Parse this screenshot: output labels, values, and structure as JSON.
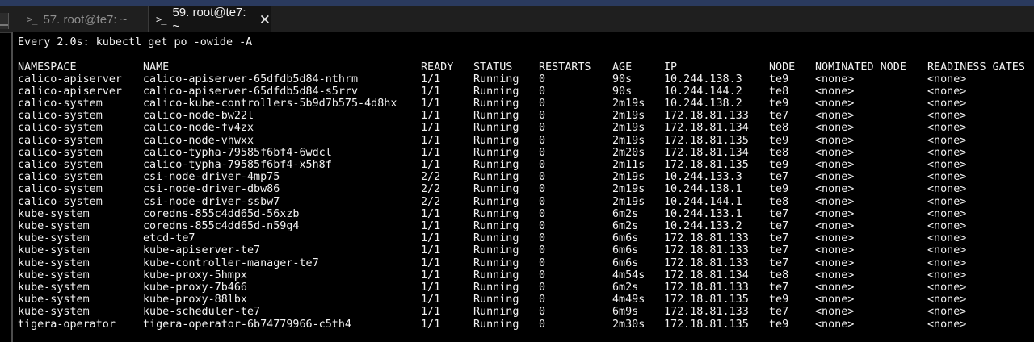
{
  "tabs": [
    {
      "prompt_icon": ">_",
      "label": "57. root@te7: ~"
    },
    {
      "prompt_icon": ">_",
      "label": "59. root@te7: ~",
      "close_glyph": "✕"
    }
  ],
  "terminal": {
    "watch_header": "Every 2.0s: kubectl get po -owide -A",
    "columns": [
      "NAMESPACE",
      "NAME",
      "READY",
      "STATUS",
      "RESTARTS",
      "AGE",
      "IP",
      "NODE",
      "NOMINATED NODE",
      "READINESS GATES"
    ],
    "rows": [
      [
        "calico-apiserver",
        "calico-apiserver-65dfdb5d84-nthrm",
        "1/1",
        "Running",
        "0",
        "90s",
        "10.244.138.3",
        "te9",
        "<none>",
        "<none>"
      ],
      [
        "calico-apiserver",
        "calico-apiserver-65dfdb5d84-s5rrv",
        "1/1",
        "Running",
        "0",
        "90s",
        "10.244.144.2",
        "te8",
        "<none>",
        "<none>"
      ],
      [
        "calico-system",
        "calico-kube-controllers-5b9d7b575-4d8hx",
        "1/1",
        "Running",
        "0",
        "2m19s",
        "10.244.138.2",
        "te9",
        "<none>",
        "<none>"
      ],
      [
        "calico-system",
        "calico-node-bw22l",
        "1/1",
        "Running",
        "0",
        "2m19s",
        "172.18.81.133",
        "te7",
        "<none>",
        "<none>"
      ],
      [
        "calico-system",
        "calico-node-fv4zx",
        "1/1",
        "Running",
        "0",
        "2m19s",
        "172.18.81.134",
        "te8",
        "<none>",
        "<none>"
      ],
      [
        "calico-system",
        "calico-node-vhwxx",
        "1/1",
        "Running",
        "0",
        "2m19s",
        "172.18.81.135",
        "te9",
        "<none>",
        "<none>"
      ],
      [
        "calico-system",
        "calico-typha-79585f6bf4-6wdcl",
        "1/1",
        "Running",
        "0",
        "2m20s",
        "172.18.81.134",
        "te8",
        "<none>",
        "<none>"
      ],
      [
        "calico-system",
        "calico-typha-79585f6bf4-x5h8f",
        "1/1",
        "Running",
        "0",
        "2m11s",
        "172.18.81.135",
        "te9",
        "<none>",
        "<none>"
      ],
      [
        "calico-system",
        "csi-node-driver-4mp75",
        "2/2",
        "Running",
        "0",
        "2m19s",
        "10.244.133.3",
        "te7",
        "<none>",
        "<none>"
      ],
      [
        "calico-system",
        "csi-node-driver-dbw86",
        "2/2",
        "Running",
        "0",
        "2m19s",
        "10.244.138.1",
        "te9",
        "<none>",
        "<none>"
      ],
      [
        "calico-system",
        "csi-node-driver-ssbw7",
        "2/2",
        "Running",
        "0",
        "2m19s",
        "10.244.144.1",
        "te8",
        "<none>",
        "<none>"
      ],
      [
        "kube-system",
        "coredns-855c4dd65d-56xzb",
        "1/1",
        "Running",
        "0",
        "6m2s",
        "10.244.133.1",
        "te7",
        "<none>",
        "<none>"
      ],
      [
        "kube-system",
        "coredns-855c4dd65d-n59g4",
        "1/1",
        "Running",
        "0",
        "6m2s",
        "10.244.133.2",
        "te7",
        "<none>",
        "<none>"
      ],
      [
        "kube-system",
        "etcd-te7",
        "1/1",
        "Running",
        "0",
        "6m6s",
        "172.18.81.133",
        "te7",
        "<none>",
        "<none>"
      ],
      [
        "kube-system",
        "kube-apiserver-te7",
        "1/1",
        "Running",
        "0",
        "6m6s",
        "172.18.81.133",
        "te7",
        "<none>",
        "<none>"
      ],
      [
        "kube-system",
        "kube-controller-manager-te7",
        "1/1",
        "Running",
        "0",
        "6m6s",
        "172.18.81.133",
        "te7",
        "<none>",
        "<none>"
      ],
      [
        "kube-system",
        "kube-proxy-5hmpx",
        "1/1",
        "Running",
        "0",
        "4m54s",
        "172.18.81.134",
        "te8",
        "<none>",
        "<none>"
      ],
      [
        "kube-system",
        "kube-proxy-7b466",
        "1/1",
        "Running",
        "0",
        "6m2s",
        "172.18.81.133",
        "te7",
        "<none>",
        "<none>"
      ],
      [
        "kube-system",
        "kube-proxy-88lbx",
        "1/1",
        "Running",
        "0",
        "4m49s",
        "172.18.81.135",
        "te9",
        "<none>",
        "<none>"
      ],
      [
        "kube-system",
        "kube-scheduler-te7",
        "1/1",
        "Running",
        "0",
        "6m9s",
        "172.18.81.133",
        "te7",
        "<none>",
        "<none>"
      ],
      [
        "tigera-operator",
        "tigera-operator-6b74779966-c5th4",
        "1/1",
        "Running",
        "0",
        "2m30s",
        "172.18.81.135",
        "te9",
        "<none>",
        "<none>"
      ]
    ]
  },
  "colors": {
    "terminal_bg": "#000000",
    "terminal_fg": "#f2f2f2",
    "tabbar_bg": "#1f1f1f",
    "active_tab_bg": "#141414",
    "inactive_tab_fg": "#8f8f8f",
    "top_stripe": "#2a3a5e"
  }
}
